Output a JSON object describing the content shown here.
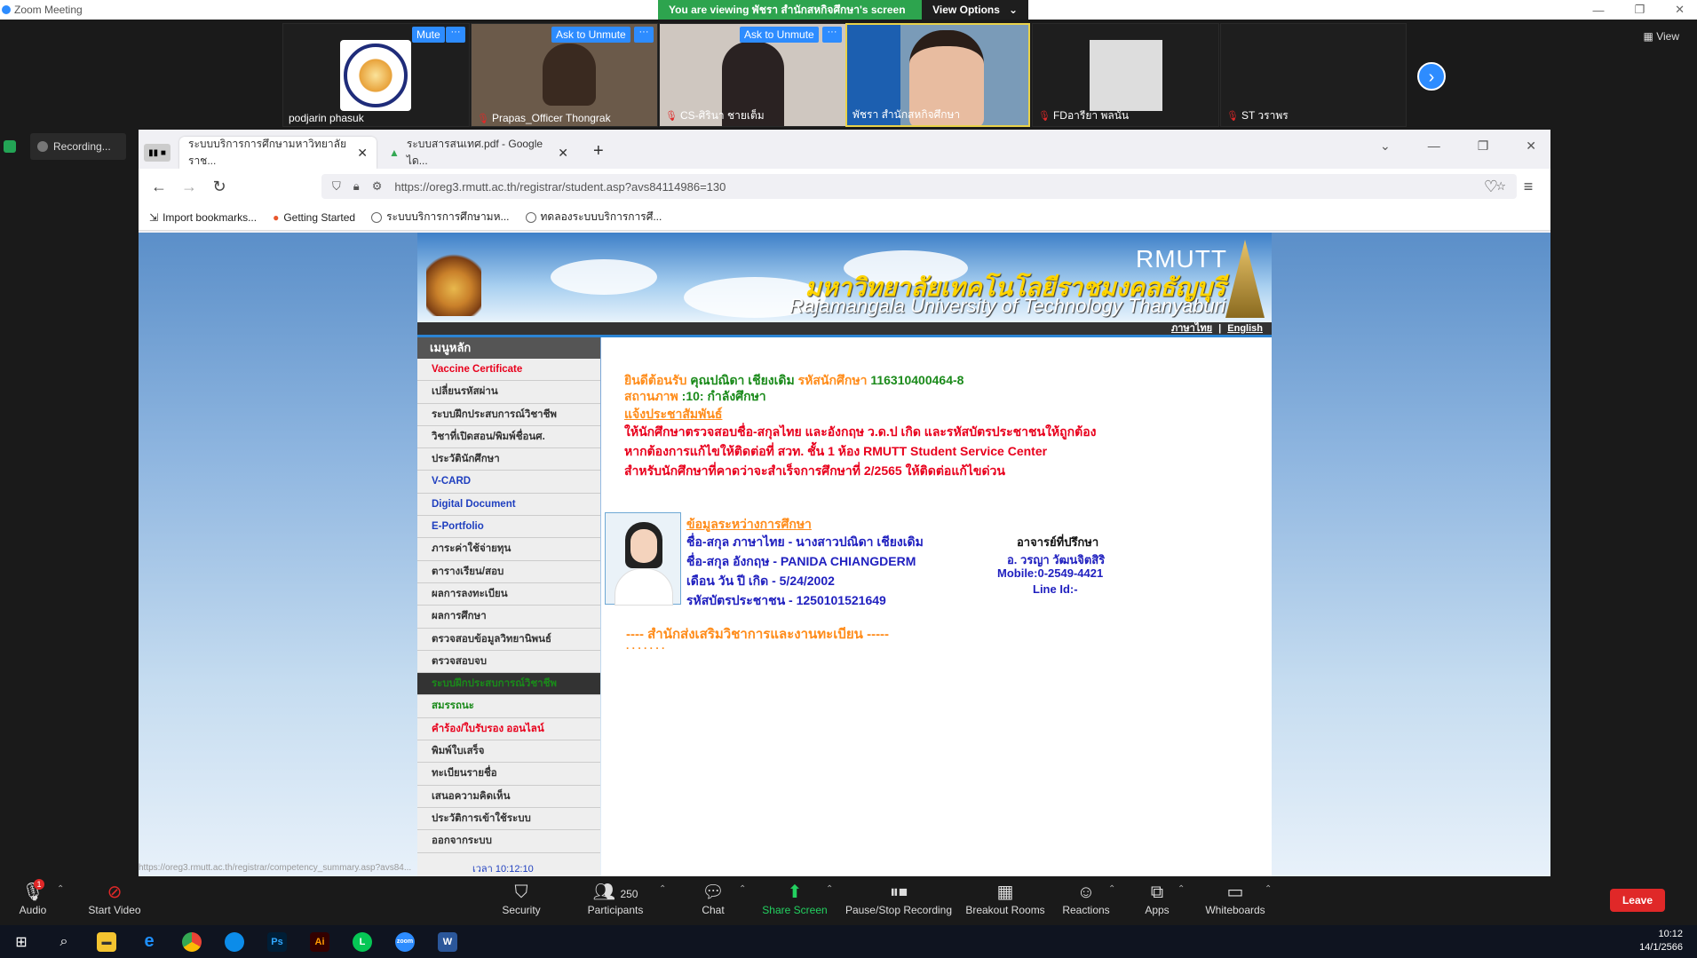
{
  "zoom": {
    "window_title": "Zoom Meeting",
    "share_banner": "You are viewing พัชรา สำนักสหกิจศึกษา's screen",
    "view_options": "View Options",
    "view_label": "View",
    "recording_label": "Recording...",
    "participants": [
      {
        "name": "podjarin phasuk",
        "chip": "Mute"
      },
      {
        "name": "Prapas_Officer Thongrak",
        "chip": "Ask to Unmute"
      },
      {
        "name": "CS-ศิรินา ชายเต็ม",
        "chip": "Ask to Unmute"
      },
      {
        "name": "พัชรา สำนักสหกิจศึกษา",
        "chip": ""
      },
      {
        "name": "FDอารียา พลนัน",
        "chip": ""
      },
      {
        "name": "ST วราพร",
        "chip": ""
      }
    ],
    "toolbar": {
      "audio": "Audio",
      "start_video": "Start Video",
      "security": "Security",
      "participants": "Participants",
      "participants_count": "250",
      "chat": "Chat",
      "share_screen": "Share Screen",
      "pause_stop": "Pause/Stop Recording",
      "breakout": "Breakout Rooms",
      "reactions": "Reactions",
      "apps": "Apps",
      "whiteboards": "Whiteboards",
      "leave": "Leave",
      "audio_badge": "1"
    }
  },
  "browser": {
    "tabs": [
      {
        "title": "ระบบบริการการศึกษามหาวิทยาลัยราช..."
      },
      {
        "title": "ระบบสารสนเทศ.pdf - Google ได..."
      }
    ],
    "url": "https://oreg3.rmutt.ac.th/registrar/student.asp?avs84114986=130",
    "bookmarks": [
      "Import bookmarks...",
      "Getting Started",
      "ระบบบริการการศึกษามห...",
      "ทดลองระบบบริการการศึ..."
    ],
    "status_url": "https://oreg3.rmutt.ac.th/registrar/competency_summary.asp?avs84..."
  },
  "site": {
    "rmutt": "RMUTT",
    "thai_name": "มหาวิทยาลัยเทคโนโลยีราชมงคลธัญบุรี",
    "eng_name": "Rajamangala University of Technology Thanyaburi",
    "lang_thai": "ภาษาไทย",
    "lang_sep": "|",
    "lang_eng": "English",
    "menu_title": "เมนูหลัก",
    "menu": [
      {
        "label": "Vaccine Certificate",
        "color": "red"
      },
      {
        "label": "เปลี่ยนรหัสผ่าน",
        "color": ""
      },
      {
        "label": "ระบบฝึกประสบการณ์วิชาชีพ",
        "color": ""
      },
      {
        "label": "วิชาที่เปิดสอน/พิมพ์ชื่อนศ.",
        "color": ""
      },
      {
        "label": "ประวัตินักศึกษา",
        "color": ""
      },
      {
        "label": "V-CARD",
        "color": "blue"
      },
      {
        "label": "Digital Document",
        "color": "blue"
      },
      {
        "label": "E-Portfolio",
        "color": "blue"
      },
      {
        "label": "ภาระค่าใช้จ่ายทุน",
        "color": ""
      },
      {
        "label": "ตารางเรียน/สอบ",
        "color": ""
      },
      {
        "label": "ผลการลงทะเบียน",
        "color": ""
      },
      {
        "label": "ผลการศึกษา",
        "color": ""
      },
      {
        "label": "ตรวจสอบข้อมูลวิทยานิพนธ์",
        "color": ""
      },
      {
        "label": "ตรวจสอบจบ",
        "color": ""
      },
      {
        "label": "ระบบฝึกประสบการณ์วิชาชีพ",
        "color": "sel"
      },
      {
        "label": "สมรรถนะ",
        "color": "green"
      },
      {
        "label": "คำร้อง/ใบรับรอง ออนไลน์",
        "color": "red"
      },
      {
        "label": "พิมพ์ใบเสร็จ",
        "color": ""
      },
      {
        "label": "ทะเบียนรายชื่อ",
        "color": ""
      },
      {
        "label": "เสนอความคิดเห็น",
        "color": ""
      },
      {
        "label": "ประวัติการเข้าใช้ระบบ",
        "color": ""
      },
      {
        "label": "ออกจากระบบ",
        "color": ""
      }
    ],
    "clock": "เวลา 10:12:10",
    "welcome_prefix": "ยินดีต้อนรับ",
    "student_name": "คุณปณิดา เชียงเดิม",
    "id_prefix": "รหัสนักศึกษา",
    "student_id": "116310400464-8",
    "status_prefix": "สถานภาพ",
    "status_value": ":10: กำลังศึกษา",
    "announce_title": "แจ้งประชาสัมพันธ์",
    "announce_1": "ให้นักศึกษาตรวจสอบชื่อ-สกุลไทย และอังกฤษ ว.ด.ป เกิด และรหัสบัตรประชาชนให้ถูกต้อง",
    "announce_2": "หากต้องการแก้ไขให้ติดต่อที่ สวท. ชั้น 1 ห้อง RMUTT Student Service Center",
    "announce_3": "สำหรับนักศึกษาที่คาดว่าจะสำเร็จการศึกษาที่ 2/2565 ให้ติดต่อแก้ไขด่วน",
    "info_title": "ข้อมูลระหว่างการศึกษา",
    "name_th": "ชื่อ-สกุล ภาษาไทย - นางสาวปณิดา เชียงเดิม",
    "name_en": "ชื่อ-สกุล อังกฤษ - PANIDA CHIANGDERM",
    "dob": "เดือน วัน ปี เกิด - 5/24/2002",
    "citizen_id": "รหัสบัตรประชาชน - 1250101521649",
    "advisor_title": "อาจารย์ที่ปรึกษา",
    "advisor_name": "อ. วรญา วัฒนจิตสิริ",
    "advisor_mobile": "Mobile:0-2549-4421",
    "advisor_line": "Line Id:-",
    "footer_office": "---- สำนักส่งเสริมวิชาการและงานทะเบียน -----",
    "footer_dots": ". . . . . . ."
  },
  "taskbar": {
    "time": "10:12",
    "date": "14/1/2566"
  }
}
